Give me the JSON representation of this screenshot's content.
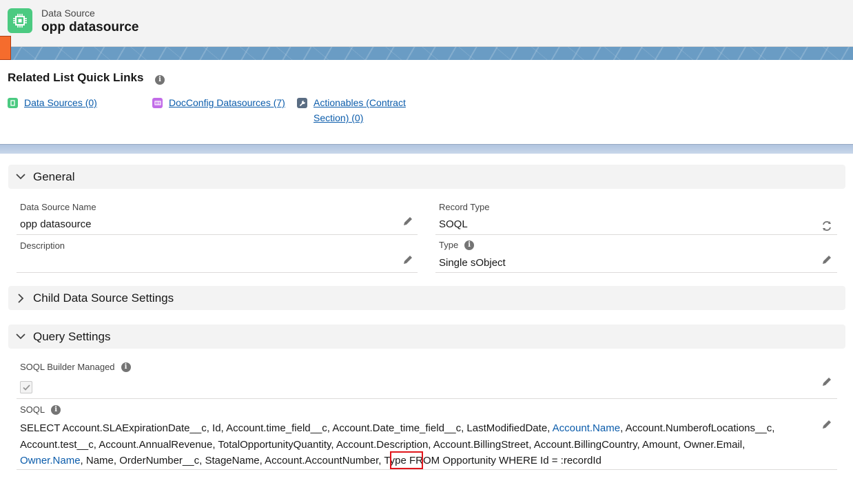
{
  "header": {
    "object_type": "Data Source",
    "title": "opp datasource"
  },
  "quick_links": {
    "title": "Related List Quick Links",
    "items": [
      {
        "label": "Data Sources (0)",
        "color": "#4bca81"
      },
      {
        "label": "DocConfig Datasources (7)",
        "color": "#c26ce8"
      },
      {
        "label_line1": "Actionables (Contract",
        "label_line2": "Section) (0)",
        "color": "#5a6d83"
      }
    ]
  },
  "sections": {
    "general": {
      "title": "General"
    },
    "child": {
      "title": "Child Data Source Settings"
    },
    "query": {
      "title": "Query Settings"
    }
  },
  "fields": {
    "data_source_name": {
      "label": "Data Source Name",
      "value": "opp datasource"
    },
    "record_type": {
      "label": "Record Type",
      "value": "SOQL"
    },
    "description": {
      "label": "Description",
      "value": ""
    },
    "type": {
      "label": "Type",
      "value": "Single sObject"
    },
    "soql_builder_managed": {
      "label": "SOQL Builder Managed",
      "checked": true
    },
    "soql": {
      "label": "SOQL",
      "part1": "SELECT Account.SLAExpirationDate__c, Id, Account.time_field__c, Account.Date_time_field__c, LastModifiedDate, ",
      "link1": "Account.Name",
      "part2": ", Account.NumberofLocations__c, Account.test__c, Account.AnnualRevenue, TotalOpportunityQuantity, Account.Description, Account.BillingStreet, Account.BillingCountry, Amount, Owner.Email, ",
      "link2": "Owner.Name",
      "part3": ", Name, OrderNumber__c, StageName, Account.AccountNumber, ",
      "highlight": "Type",
      "part4": " FROM Opportunity WHERE Id = :recordId"
    }
  },
  "colors": {
    "accent": "#0b5cab",
    "highlight_box": "#e0161c",
    "app_icon": "#4bca81"
  }
}
